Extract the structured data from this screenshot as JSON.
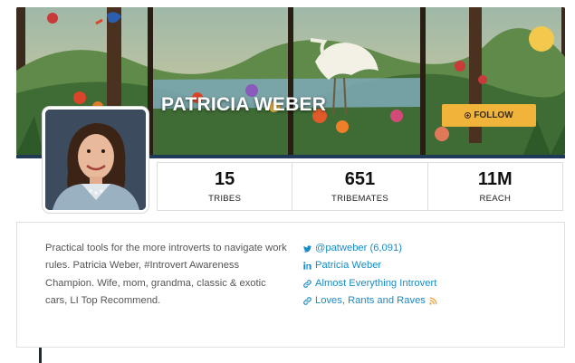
{
  "profile": {
    "name": "PATRICIA WEBER",
    "follow_label": "FOLLOW"
  },
  "stats": [
    {
      "value": "15",
      "label": "TRIBES"
    },
    {
      "value": "651",
      "label": "TRIBEMATES"
    },
    {
      "value": "11M",
      "label": "REACH"
    }
  ],
  "bio": "Practical tools for the more introverts to navigate work rules. Patricia Weber, #Introvert Awareness Champion. Wife, mom, grandma, classic & exotic cars, LI Top Recommend.",
  "links": [
    {
      "icon": "twitter-icon",
      "text": "@patweber (6,091)"
    },
    {
      "icon": "linkedin-icon",
      "text": "Patricia Weber"
    },
    {
      "icon": "link-icon",
      "text": "Almost Everything Introvert"
    },
    {
      "icon": "link-icon",
      "text": "Loves, Rants and Raves",
      "extra_icon": "rss-icon"
    }
  ],
  "colors": {
    "accent_link": "#1a8bc7",
    "follow_button": "#f0b43a",
    "banner_bar": "#1e3a57",
    "rss": "#f29a2e"
  }
}
